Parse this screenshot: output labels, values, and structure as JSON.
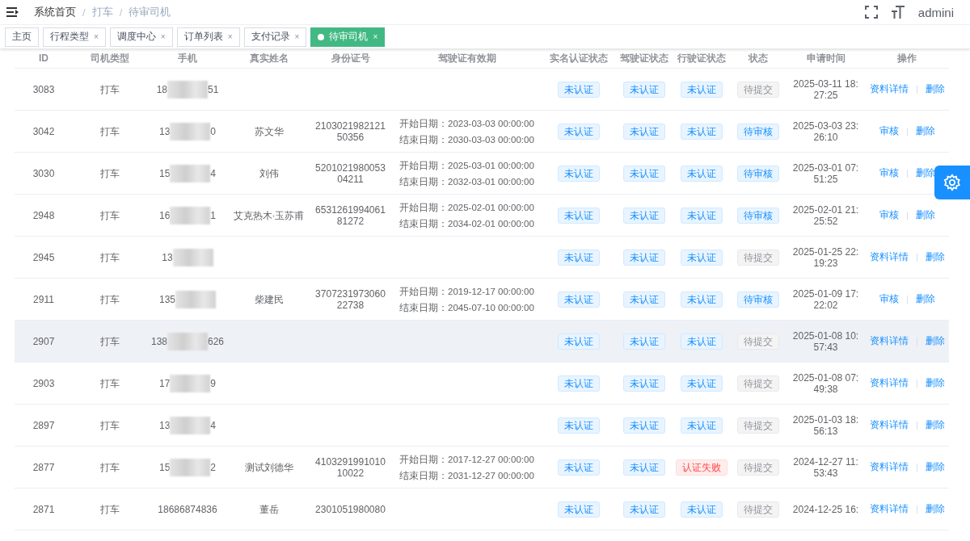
{
  "breadcrumb": [
    "系统首页",
    "打车",
    "待审司机"
  ],
  "breadcrumb_separators": [
    "/",
    "/"
  ],
  "user": {
    "name": "admini"
  },
  "tabs": [
    {
      "label": "主页",
      "selected": false
    },
    {
      "label": "行程类型",
      "selected": false,
      "close": "×"
    },
    {
      "label": "调度中心",
      "selected": false,
      "close": "×"
    },
    {
      "label": "订单列表",
      "selected": false,
      "close": "×"
    },
    {
      "label": "支付记录",
      "selected": false,
      "close": "×"
    },
    {
      "label": "待审司机",
      "selected": true,
      "close": "×"
    }
  ],
  "table": {
    "columns": [
      "ID",
      "司机类型",
      "手机",
      "真实姓名",
      "身份证号",
      "驾驶证有效期",
      "实名认证状态",
      "驾驶证状态",
      "行驶证状态",
      "状态",
      "申请时间",
      "操作"
    ],
    "rows": [
      {
        "id": "3083",
        "driver_type": "打车",
        "phone_prefix": "18",
        "phone_suffix": "51",
        "real_name": "",
        "id_number": [],
        "validity": [],
        "tags": [
          {
            "label": "未认证",
            "kind": "info"
          },
          {
            "label": "未认证",
            "kind": "info"
          },
          {
            "label": "未认证",
            "kind": "info"
          },
          {
            "label": "待提交",
            "kind": "neutral"
          }
        ],
        "applied": [
          "2025-03-11 18:",
          "27:25"
        ],
        "actions": [
          "资料详情",
          "删除"
        ],
        "highlighted": false
      },
      {
        "id": "3042",
        "driver_type": "打车",
        "phone_prefix": "13",
        "phone_suffix": "0",
        "real_name": "苏文华",
        "id_number": [
          "2103021982121",
          "50356"
        ],
        "validity": [
          "开始日期：2023-03-03 00:00:00",
          "结束日期：2030-03-03 00:00:00"
        ],
        "tags": [
          {
            "label": "未认证",
            "kind": "info"
          },
          {
            "label": "未认证",
            "kind": "info"
          },
          {
            "label": "未认证",
            "kind": "info"
          },
          {
            "label": "待审核",
            "kind": "info"
          }
        ],
        "applied": [
          "2025-03-03 23:",
          "26:10"
        ],
        "actions": [
          "审核",
          "删除"
        ],
        "highlighted": false
      },
      {
        "id": "3030",
        "driver_type": "打车",
        "phone_prefix": "15",
        "phone_suffix": "4",
        "real_name": "刘伟",
        "id_number": [
          "5201021980053",
          "04211"
        ],
        "validity": [
          "开始日期：2025-03-01 00:00:00",
          "结束日期：2032-03-01 00:00:00"
        ],
        "tags": [
          {
            "label": "未认证",
            "kind": "info"
          },
          {
            "label": "未认证",
            "kind": "info"
          },
          {
            "label": "未认证",
            "kind": "info"
          },
          {
            "label": "待审核",
            "kind": "info"
          }
        ],
        "applied": [
          "2025-03-01 07:",
          "51:25"
        ],
        "actions": [
          "审核",
          "删除"
        ],
        "highlighted": false
      },
      {
        "id": "2948",
        "driver_type": "打车",
        "phone_prefix": "16",
        "phone_suffix": "1",
        "real_name": "艾克热木·玉苏甫",
        "id_number": [
          "6531261994061",
          "81272"
        ],
        "validity": [
          "开始日期：2025-02-01 00:00:00",
          "结束日期：2034-02-01 00:00:00"
        ],
        "tags": [
          {
            "label": "未认证",
            "kind": "info"
          },
          {
            "label": "未认证",
            "kind": "info"
          },
          {
            "label": "未认证",
            "kind": "info"
          },
          {
            "label": "待审核",
            "kind": "info"
          }
        ],
        "applied": [
          "2025-02-01 21:",
          "25:52"
        ],
        "actions": [
          "审核",
          "删除"
        ],
        "highlighted": false
      },
      {
        "id": "2945",
        "driver_type": "打车",
        "phone_prefix": "13",
        "phone_suffix": "",
        "real_name": "",
        "id_number": [],
        "validity": [],
        "tags": [
          {
            "label": "未认证",
            "kind": "info"
          },
          {
            "label": "未认证",
            "kind": "info"
          },
          {
            "label": "未认证",
            "kind": "info"
          },
          {
            "label": "待提交",
            "kind": "neutral"
          }
        ],
        "applied": [
          "2025-01-25 22:",
          "19:23"
        ],
        "actions": [
          "资料详情",
          "删除"
        ],
        "highlighted": false
      },
      {
        "id": "2911",
        "driver_type": "打车",
        "phone_prefix": "135",
        "phone_suffix": "",
        "real_name": "柴建民",
        "id_number": [
          "3707231973060",
          "22738"
        ],
        "validity": [
          "开始日期：2019-12-17 00:00:00",
          "结束日期：2045-07-10 00:00:00"
        ],
        "tags": [
          {
            "label": "未认证",
            "kind": "info"
          },
          {
            "label": "未认证",
            "kind": "info"
          },
          {
            "label": "未认证",
            "kind": "info"
          },
          {
            "label": "待审核",
            "kind": "info"
          }
        ],
        "applied": [
          "2025-01-09 17:",
          "22:02"
        ],
        "actions": [
          "审核",
          "删除"
        ],
        "highlighted": false
      },
      {
        "id": "2907",
        "driver_type": "打车",
        "phone_prefix": "138",
        "phone_suffix": "626",
        "real_name": "",
        "id_number": [],
        "validity": [],
        "tags": [
          {
            "label": "未认证",
            "kind": "info"
          },
          {
            "label": "未认证",
            "kind": "info"
          },
          {
            "label": "未认证",
            "kind": "info"
          },
          {
            "label": "待提交",
            "kind": "neutral"
          }
        ],
        "applied": [
          "2025-01-08 10:",
          "57:43"
        ],
        "actions": [
          "资料详情",
          "删除"
        ],
        "highlighted": true
      },
      {
        "id": "2903",
        "driver_type": "打车",
        "phone_prefix": "17",
        "phone_suffix": "9",
        "real_name": "",
        "id_number": [],
        "validity": [],
        "tags": [
          {
            "label": "未认证",
            "kind": "info"
          },
          {
            "label": "未认证",
            "kind": "info"
          },
          {
            "label": "未认证",
            "kind": "info"
          },
          {
            "label": "待提交",
            "kind": "neutral"
          }
        ],
        "applied": [
          "2025-01-08 07:",
          "49:38"
        ],
        "actions": [
          "资料详情",
          "删除"
        ],
        "highlighted": false
      },
      {
        "id": "2897",
        "driver_type": "打车",
        "phone_prefix": "13",
        "phone_suffix": "4",
        "real_name": "",
        "id_number": [],
        "validity": [],
        "tags": [
          {
            "label": "未认证",
            "kind": "info"
          },
          {
            "label": "未认证",
            "kind": "info"
          },
          {
            "label": "未认证",
            "kind": "info"
          },
          {
            "label": "待提交",
            "kind": "neutral"
          }
        ],
        "applied": [
          "2025-01-03 18:",
          "56:13"
        ],
        "actions": [
          "资料详情",
          "删除"
        ],
        "highlighted": false
      },
      {
        "id": "2877",
        "driver_type": "打车",
        "phone_prefix": "15",
        "phone_suffix": "2",
        "real_name": "测试刘德华",
        "id_number": [
          "4103291991010",
          "10022"
        ],
        "validity": [
          "开始日期：2017-12-27 00:00:00",
          "结束日期：2031-12-27 00:00:00"
        ],
        "tags": [
          {
            "label": "未认证",
            "kind": "info"
          },
          {
            "label": "未认证",
            "kind": "info"
          },
          {
            "label": "认证失败",
            "kind": "danger"
          },
          {
            "label": "待提交",
            "kind": "neutral"
          }
        ],
        "applied": [
          "2024-12-27 11:",
          "53:43"
        ],
        "actions": [
          "资料详情",
          "删除"
        ],
        "highlighted": false
      },
      {
        "id": "2871",
        "driver_type": "打车",
        "phone_prefix": "18686874836",
        "phone_suffix": "",
        "real_name": "董岳",
        "id_number": [
          "2301051980080"
        ],
        "validity": [],
        "tags": [
          {
            "label": "未认证",
            "kind": "info"
          },
          {
            "label": "未认证",
            "kind": "info"
          },
          {
            "label": "未认证",
            "kind": "info"
          },
          {
            "label": "待提交",
            "kind": "neutral"
          }
        ],
        "applied": [
          "2024-12-25 16:"
        ],
        "actions": [
          "资料详情",
          "删除"
        ],
        "highlighted": false
      }
    ]
  }
}
